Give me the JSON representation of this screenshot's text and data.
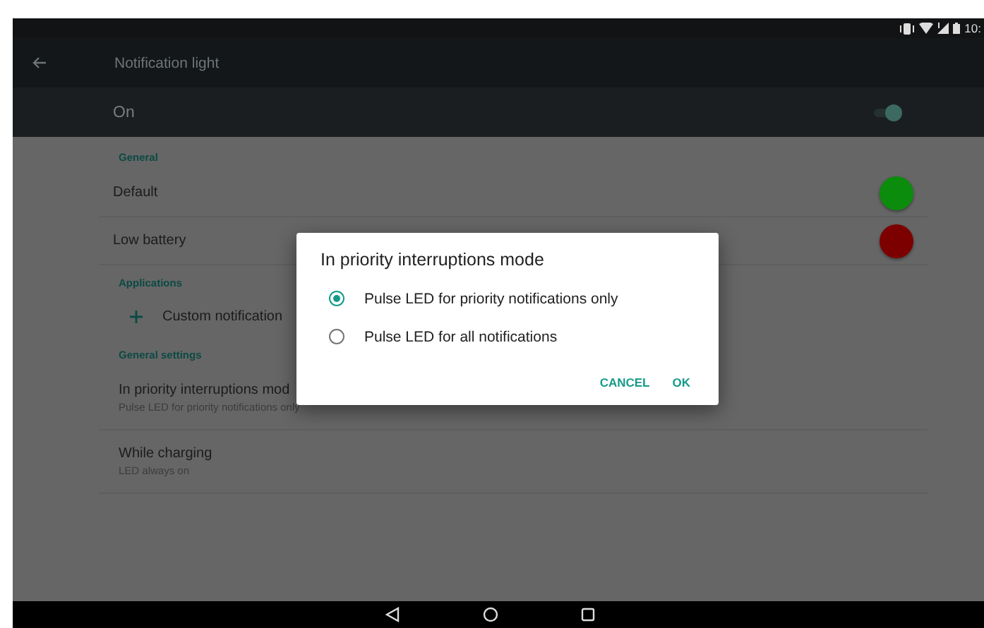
{
  "status_bar": {
    "time": "10:"
  },
  "toolbar": {
    "title": "Notification light"
  },
  "master_switch": {
    "label": "On",
    "on": true
  },
  "sections": [
    {
      "header": "General",
      "items": [
        {
          "kind": "color",
          "title": "Default",
          "color": "#0c8c0c"
        },
        {
          "kind": "color",
          "title": "Low battery",
          "color": "#7d0000"
        }
      ]
    },
    {
      "header": "Applications",
      "items": [
        {
          "kind": "add",
          "title": "Custom notification"
        }
      ]
    },
    {
      "header": "General settings",
      "items": [
        {
          "kind": "text",
          "title": "In priority interruptions mod",
          "summary": "Pulse LED for priority notifications only"
        },
        {
          "kind": "text",
          "title": "While charging",
          "summary": "LED always on"
        }
      ]
    }
  ],
  "dialog": {
    "title": "In priority interruptions mode",
    "options": [
      {
        "label": "Pulse LED for priority notifications only",
        "selected": true
      },
      {
        "label": "Pulse LED for all notifications",
        "selected": false
      }
    ],
    "buttons": [
      "CANCEL",
      "OK"
    ]
  }
}
